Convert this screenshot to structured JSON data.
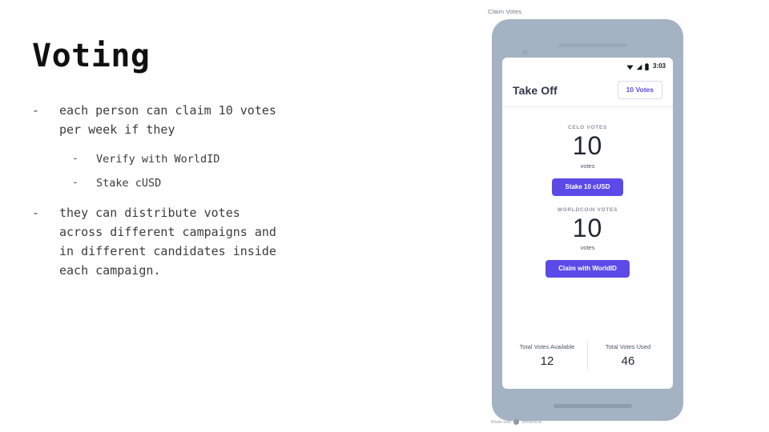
{
  "slide": {
    "title": "Voting",
    "bullets": [
      {
        "dash": "-",
        "text": "each person can claim 10 votes\nper week if they",
        "children": [
          {
            "dash": "-",
            "text": "Verify with WorldID"
          },
          {
            "dash": "-",
            "text": "Stake cUSD"
          }
        ]
      },
      {
        "dash": "-",
        "text": "they can distribute votes\nacross different campaigns and\nin different candidates inside\neach campaign.",
        "children": []
      }
    ]
  },
  "mockup": {
    "label": "Claim Votes",
    "frame_color": "#a3b3c3",
    "accent_color": "#5b4ae8",
    "status_bar": {
      "wifi_icon": "wifi-icon",
      "signal_icon": "signal-icon",
      "battery_icon": "battery-icon",
      "time": "3:03"
    },
    "header": {
      "title": "Take Off",
      "chip_label": "10 Votes"
    },
    "sections": [
      {
        "label": "CELO VOTES",
        "number": "10",
        "unit": "votes",
        "button": "Stake 10 cUSD"
      },
      {
        "label": "WORLDCOIN VOTES",
        "number": "10",
        "unit": "votes",
        "button": "Claim with WorldID"
      }
    ],
    "stats": [
      {
        "label": "Total Votes Available",
        "value": "12"
      },
      {
        "label": "Total Votes Used",
        "value": "46"
      }
    ]
  },
  "watermark": {
    "text": "Made with",
    "brand": "Whimsical"
  }
}
